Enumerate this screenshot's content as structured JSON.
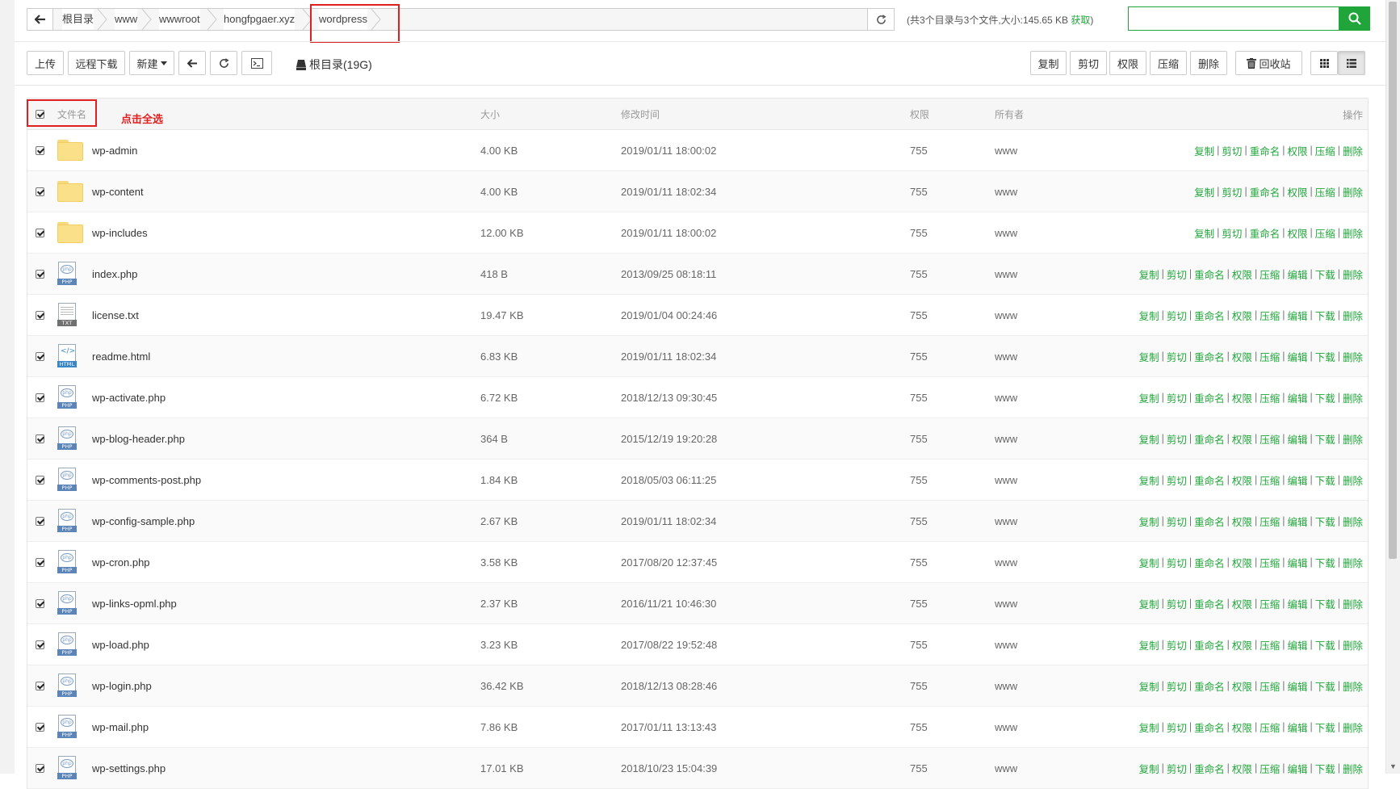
{
  "breadcrumb": {
    "items": [
      "根目录",
      "www",
      "wwwroot",
      "hongfpgaer.xyz",
      "wordpress"
    ]
  },
  "dir_info": {
    "text": "(共3个目录与3个文件,大小:145.65 KB",
    "fetch": "获取",
    "close": ")"
  },
  "search": {
    "placeholder": "",
    "value": ""
  },
  "toolbar": {
    "upload": "上传",
    "remote_download": "远程下载",
    "new": "新建",
    "disk": "根目录(19G)",
    "copy": "复制",
    "cut": "剪切",
    "permission": "权限",
    "compress": "压缩",
    "delete": "删除",
    "recycle": "回收站"
  },
  "table": {
    "headers": {
      "name": "文件名",
      "size": "大小",
      "mtime": "修改时间",
      "perm": "权限",
      "owner": "所有者",
      "ops": "操作"
    },
    "select_all_hint": "点击全选",
    "rows": [
      {
        "name": "wp-admin",
        "type": "folder",
        "size": "4.00 KB",
        "mtime": "2019/01/11 18:00:02",
        "perm": "755",
        "owner": "www"
      },
      {
        "name": "wp-content",
        "type": "folder",
        "size": "4.00 KB",
        "mtime": "2019/01/11 18:02:34",
        "perm": "755",
        "owner": "www"
      },
      {
        "name": "wp-includes",
        "type": "folder",
        "size": "12.00 KB",
        "mtime": "2019/01/11 18:00:02",
        "perm": "755",
        "owner": "www"
      },
      {
        "name": "index.php",
        "type": "php",
        "size": "418 B",
        "mtime": "2013/09/25 08:18:11",
        "perm": "755",
        "owner": "www"
      },
      {
        "name": "license.txt",
        "type": "txt",
        "size": "19.47 KB",
        "mtime": "2019/01/04 00:24:46",
        "perm": "755",
        "owner": "www"
      },
      {
        "name": "readme.html",
        "type": "html",
        "size": "6.83 KB",
        "mtime": "2019/01/11 18:02:34",
        "perm": "755",
        "owner": "www"
      },
      {
        "name": "wp-activate.php",
        "type": "php",
        "size": "6.72 KB",
        "mtime": "2018/12/13 09:30:45",
        "perm": "755",
        "owner": "www"
      },
      {
        "name": "wp-blog-header.php",
        "type": "php",
        "size": "364 B",
        "mtime": "2015/12/19 19:20:28",
        "perm": "755",
        "owner": "www"
      },
      {
        "name": "wp-comments-post.php",
        "type": "php",
        "size": "1.84 KB",
        "mtime": "2018/05/03 06:11:25",
        "perm": "755",
        "owner": "www"
      },
      {
        "name": "wp-config-sample.php",
        "type": "php",
        "size": "2.67 KB",
        "mtime": "2019/01/11 18:02:34",
        "perm": "755",
        "owner": "www"
      },
      {
        "name": "wp-cron.php",
        "type": "php",
        "size": "3.58 KB",
        "mtime": "2017/08/20 12:37:45",
        "perm": "755",
        "owner": "www"
      },
      {
        "name": "wp-links-opml.php",
        "type": "php",
        "size": "2.37 KB",
        "mtime": "2016/11/21 10:46:30",
        "perm": "755",
        "owner": "www"
      },
      {
        "name": "wp-load.php",
        "type": "php",
        "size": "3.23 KB",
        "mtime": "2017/08/22 19:52:48",
        "perm": "755",
        "owner": "www"
      },
      {
        "name": "wp-login.php",
        "type": "php",
        "size": "36.42 KB",
        "mtime": "2018/12/13 08:28:46",
        "perm": "755",
        "owner": "www"
      },
      {
        "name": "wp-mail.php",
        "type": "php",
        "size": "7.86 KB",
        "mtime": "2017/01/11 13:13:43",
        "perm": "755",
        "owner": "www"
      },
      {
        "name": "wp-settings.php",
        "type": "php",
        "size": "17.01 KB",
        "mtime": "2018/10/23 15:04:39",
        "perm": "755",
        "owner": "www"
      }
    ],
    "ops_folder": [
      "复制",
      "剪切",
      "重命名",
      "权限",
      "压缩",
      "删除"
    ],
    "ops_file": [
      "复制",
      "剪切",
      "重命名",
      "权限",
      "压缩",
      "编辑",
      "下载",
      "删除"
    ]
  },
  "icon_labels": {
    "php": "PHP",
    "txt": "TXT",
    "html": "HTML",
    "php_mark": "php",
    "html_mark": "</>"
  },
  "colors": {
    "accent": "#20a53a",
    "annotation": "#e02020"
  }
}
